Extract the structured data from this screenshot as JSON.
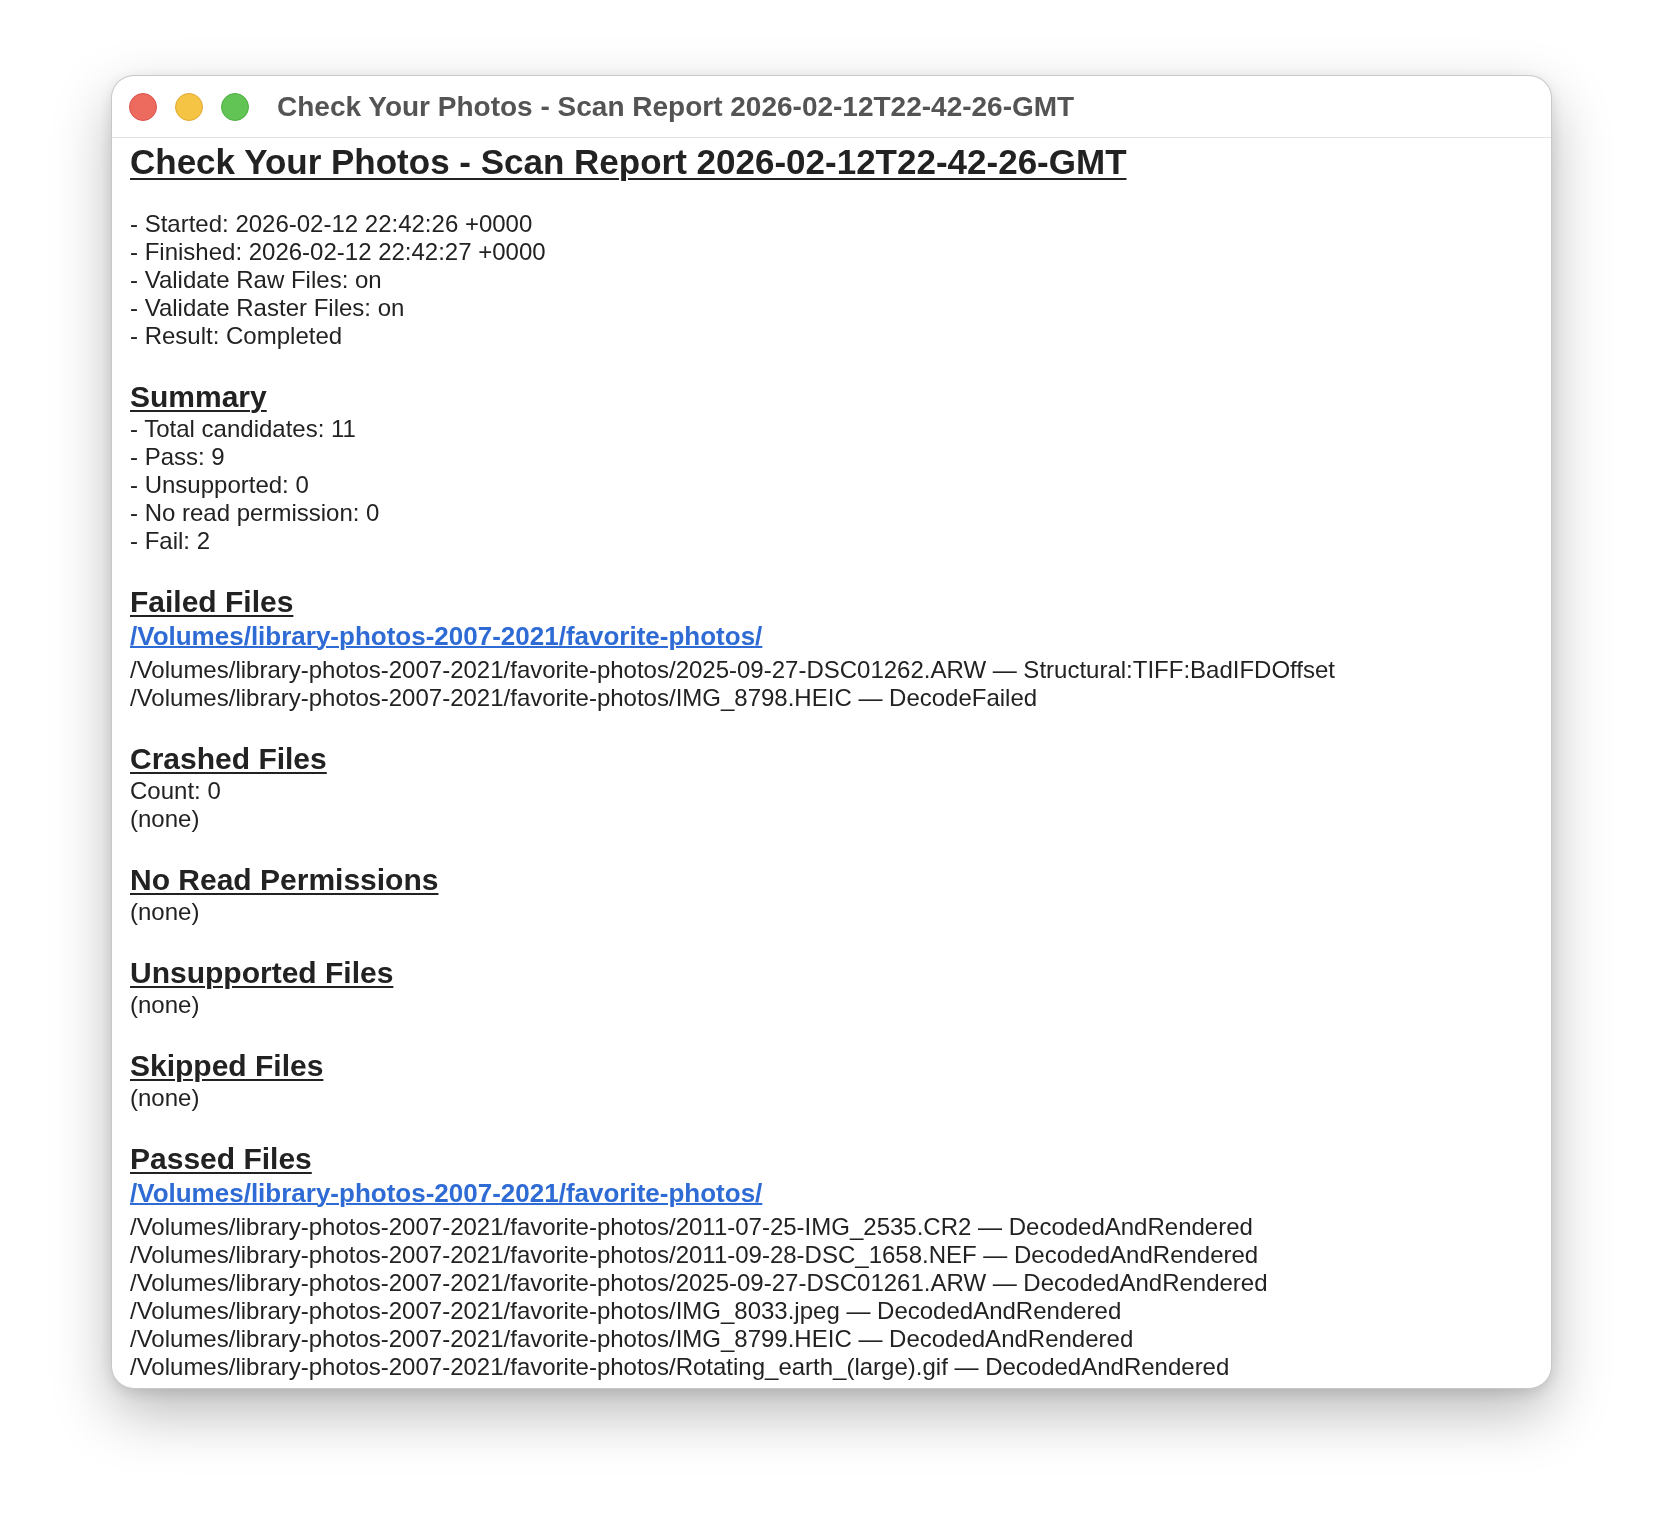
{
  "window": {
    "title": "Check Your Photos - Scan Report 2026-02-12T22-42-26-GMT"
  },
  "report": {
    "title": "Check Your Photos - Scan Report 2026-02-12T22-42-26-GMT",
    "meta": [
      "- Started: 2026-02-12 22:42:26 +0000",
      "- Finished: 2026-02-12 22:42:27 +0000",
      "- Validate Raw Files: on",
      "- Validate Raster Files: on",
      "- Result: Completed"
    ],
    "sections": [
      {
        "heading": "Summary",
        "lines": [
          "- Total candidates: 11",
          "- Pass: 9",
          "- Unsupported: 0",
          "- No read permission: 0",
          "- Fail: 2"
        ]
      },
      {
        "heading": "Failed Files",
        "folder": "/Volumes/library-photos-2007-2021/favorite-photos/",
        "lines": [
          "/Volumes/library-photos-2007-2021/favorite-photos/2025-09-27-DSC01262.ARW — Structural:TIFF:BadIFDOffset",
          "/Volumes/library-photos-2007-2021/favorite-photos/IMG_8798.HEIC — DecodeFailed"
        ]
      },
      {
        "heading": "Crashed Files",
        "lines": [
          "Count: 0",
          "(none)"
        ]
      },
      {
        "heading": "No Read Permissions",
        "lines": [
          "(none)"
        ]
      },
      {
        "heading": "Unsupported Files",
        "lines": [
          "(none)"
        ]
      },
      {
        "heading": "Skipped Files",
        "lines": [
          "(none)"
        ]
      },
      {
        "heading": "Passed Files",
        "folder": "/Volumes/library-photos-2007-2021/favorite-photos/",
        "lines": [
          "/Volumes/library-photos-2007-2021/favorite-photos/2011-07-25-IMG_2535.CR2 — DecodedAndRendered",
          "/Volumes/library-photos-2007-2021/favorite-photos/2011-09-28-DSC_1658.NEF — DecodedAndRendered",
          "/Volumes/library-photos-2007-2021/favorite-photos/2025-09-27-DSC01261.ARW — DecodedAndRendered",
          "/Volumes/library-photos-2007-2021/favorite-photos/IMG_8033.jpeg — DecodedAndRendered",
          "/Volumes/library-photos-2007-2021/favorite-photos/IMG_8799.HEIC — DecodedAndRendered",
          "/Volumes/library-photos-2007-2021/favorite-photos/Rotating_earth_(large).gif — DecodedAndRendered"
        ]
      }
    ]
  }
}
